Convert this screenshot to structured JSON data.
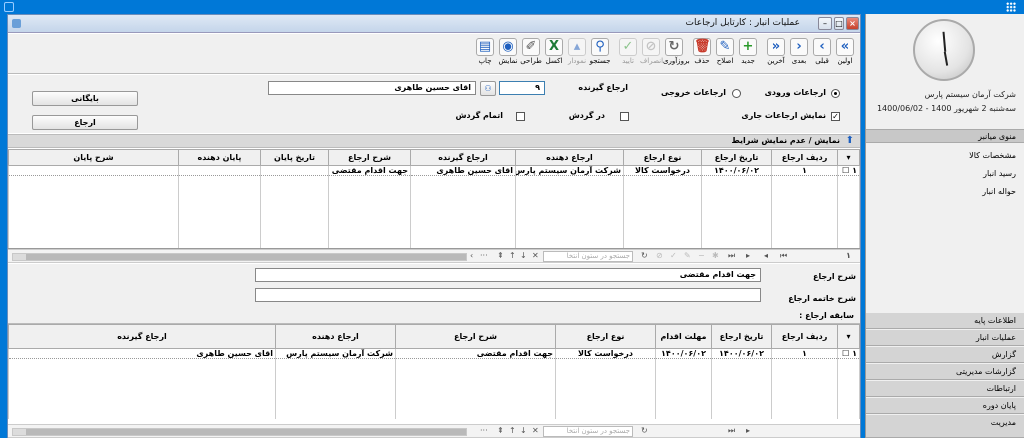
{
  "window": {
    "title": "عملیات انبار : کارتابل ارجاعات"
  },
  "toolbar": {
    "items": [
      {
        "icon": "first-icon",
        "label": "اولین"
      },
      {
        "icon": "prev-icon",
        "label": "قبلی"
      },
      {
        "icon": "next-icon",
        "label": "بعدی"
      },
      {
        "icon": "last-icon",
        "label": "آخرین"
      },
      {
        "icon": "add-icon",
        "label": "جدید"
      },
      {
        "icon": "edit-icon",
        "label": "اصلاح"
      },
      {
        "icon": "delete-icon",
        "label": "حذف"
      },
      {
        "icon": "refresh-icon",
        "label": "بروزآوری"
      },
      {
        "icon": "cancel-icon",
        "label": "انصراف"
      },
      {
        "icon": "confirm-icon",
        "label": "تایید"
      },
      {
        "icon": "search-icon",
        "label": "جستجو"
      },
      {
        "icon": "chart-icon",
        "label": "نمودار"
      },
      {
        "icon": "excel-icon",
        "label": "اکسل"
      },
      {
        "icon": "design-icon",
        "label": "طراحی"
      },
      {
        "icon": "view-icon",
        "label": "نمایش"
      },
      {
        "icon": "print-icon",
        "label": "چاپ"
      }
    ]
  },
  "filter": {
    "incoming_label": "ارجاعات ورودی",
    "outgoing_label": "ارجاعات خروجی",
    "show_current_label": "نمایش ارجاعات جاری",
    "recipient_label": "ارجاع گیرنده",
    "recipient_code": "۹",
    "recipient_name": "اقای حسین طاهری",
    "in_circulation_label": "در گردش",
    "end_circulation_label": "اتمام گردش",
    "archive_button": "بایگانی",
    "refer_button": "ارجاع"
  },
  "showbar": {
    "label": "نمایش / عدم نمایش شرایط"
  },
  "grid1": {
    "columns": [
      "ردیف ارجاع",
      "تاریخ ارجاع",
      "نوع ارجاع",
      "ارجاع دهنده",
      "ارجاع گیرنده",
      "شرح ارجاع",
      "تاریخ پایان",
      "پایان دهنده",
      "شرح پایان"
    ],
    "rows": [
      [
        "۱",
        "۱۴۰۰/۰۶/۰۲",
        "درخواست کالا",
        "شرکت آرمان سیستم پارس",
        "اقای حسین طاهری",
        "جهت اقدام مقتضی",
        "",
        "",
        ""
      ]
    ],
    "row_number": "۱"
  },
  "pager": {
    "search_placeholder": "جستجو در ستون انتخا",
    "page_number": "۱"
  },
  "detail": {
    "desc_label": "شرح ارجاع",
    "desc_value": "جهت اقدام مقتضی",
    "end_desc_label": "شرح خاتمه ارجاع",
    "end_desc_value": ""
  },
  "history": {
    "label": "سابقه ارجاع :",
    "columns": [
      "ردیف ارجاع",
      "تاریخ ارجاع",
      "مهلت اقدام",
      "نوع ارجاع",
      "شرح ارجاع",
      "ارجاع دهنده",
      "ارجاع گیرنده"
    ],
    "rows": [
      [
        "۱",
        "۱۴۰۰/۰۶/۰۲",
        "۱۴۰۰/۰۶/۰۲",
        "درخواست کالا",
        "جهت اقدام مقتضی",
        "شرکت آرمان سیستم پارس",
        "اقای حسین طاهری"
      ]
    ],
    "row_number": "۱"
  },
  "side": {
    "company": "شرکت آرمان سیستم پارس",
    "date": "سه‌شنبه 2 شهریور 1400 - 1400/06/02",
    "menu_header": "منوی میانبر",
    "menu_items": [
      "مشخصات کالا",
      "رسید انبار",
      "حواله انبار"
    ],
    "sections": [
      "اطلاعات پایه",
      "عملیات انبار",
      "گزارش",
      "گزارشات مدیریتی",
      "ارتباطات",
      "پایان دوره",
      "مدیریت"
    ]
  }
}
